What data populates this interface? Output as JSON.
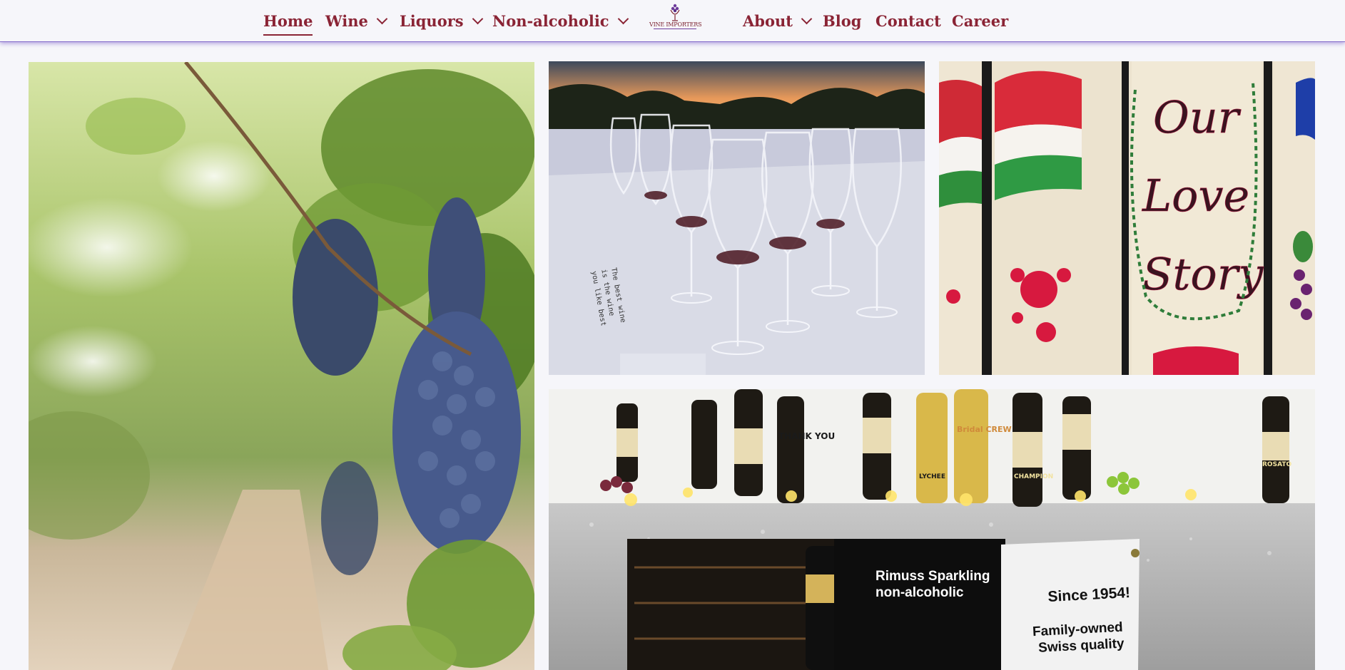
{
  "nav": {
    "left": [
      {
        "label": "Home",
        "active": true
      },
      {
        "label": "Wine",
        "dropdown": true
      },
      {
        "label": "Liquors",
        "dropdown": true
      },
      {
        "label": "Non-alcoholic",
        "dropdown": true
      }
    ],
    "logo_text": "VINE IMPORTERS",
    "right": [
      {
        "label": "About",
        "dropdown": true
      },
      {
        "label": "Blog"
      },
      {
        "label": "Contact"
      },
      {
        "label": "Career"
      }
    ]
  },
  "gallery": {
    "glasses_card_text": [
      "The best wine",
      "is the wine",
      "you like best"
    ],
    "story_sign_text": [
      "Our",
      "Love",
      "Story"
    ],
    "banner_left": [
      "Rimuss Sparkling",
      "non-alcoholic"
    ],
    "banner_right": [
      "Since 1954!",
      "Family-owned",
      "Swiss quality"
    ],
    "bottle_labels": [
      "THANK YOU",
      "LYCHEE",
      "Bridal CREW",
      "CHAMPION",
      "ROSATO"
    ]
  },
  "colors": {
    "accent": "#8a2435",
    "nav_shadow": "#8c78cc",
    "background": "#f6f6fa"
  }
}
